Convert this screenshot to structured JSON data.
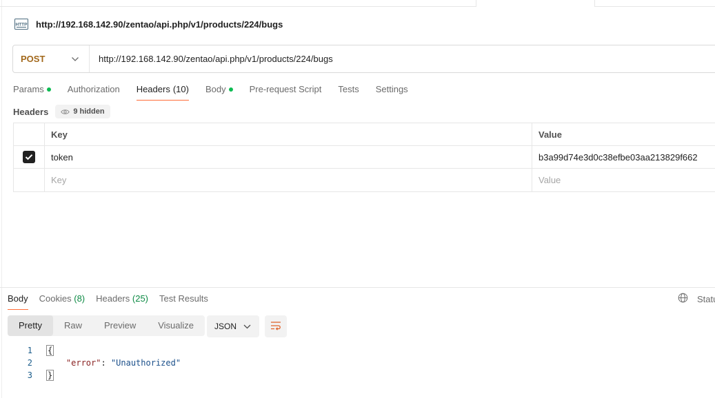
{
  "request": {
    "title": "http://192.168.142.90/zentao/api.php/v1/products/224/bugs",
    "method": "POST",
    "url": "http://192.168.142.90/zentao/api.php/v1/products/224/bugs"
  },
  "request_tabs": [
    {
      "label": "Params",
      "dot": true
    },
    {
      "label": "Authorization"
    },
    {
      "label": "Headers",
      "count": "(10)",
      "active": true
    },
    {
      "label": "Body",
      "dot": true
    },
    {
      "label": "Pre-request Script"
    },
    {
      "label": "Tests"
    },
    {
      "label": "Settings"
    }
  ],
  "headers_section": {
    "label": "Headers",
    "hidden_label": "9 hidden"
  },
  "headers_table": {
    "col_key": "Key",
    "col_value": "Value",
    "rows": [
      {
        "checked": true,
        "key": "token",
        "value": "b3a99d74e3d0c38efbe03aa213829f662"
      }
    ],
    "new_key_placeholder": "Key",
    "new_value_placeholder": "Value"
  },
  "response_tabs": [
    {
      "label": "Body",
      "active": true
    },
    {
      "label": "Cookies",
      "count": "(8)"
    },
    {
      "label": "Headers",
      "count": "(25)"
    },
    {
      "label": "Test Results"
    }
  ],
  "status": {
    "label": "Statu"
  },
  "view_modes": [
    "Pretty",
    "Raw",
    "Preview",
    "Visualize"
  ],
  "active_view_mode": "Pretty",
  "format": "JSON",
  "code": {
    "line_numbers": [
      "1",
      "2",
      "3"
    ],
    "open_brace": "{",
    "key": "\"error\"",
    "colon": ": ",
    "value": "\"Unauthorized\"",
    "close_brace": "}"
  },
  "colors": {
    "accent": "#ff6c37",
    "method_post": "#a2681b",
    "dot_green": "#0cbb52"
  },
  "icons": [
    "http-icon",
    "chevron-down-icon",
    "eye-icon",
    "checkbox-checked-icon",
    "globe-icon",
    "wrap-lines-icon"
  ]
}
